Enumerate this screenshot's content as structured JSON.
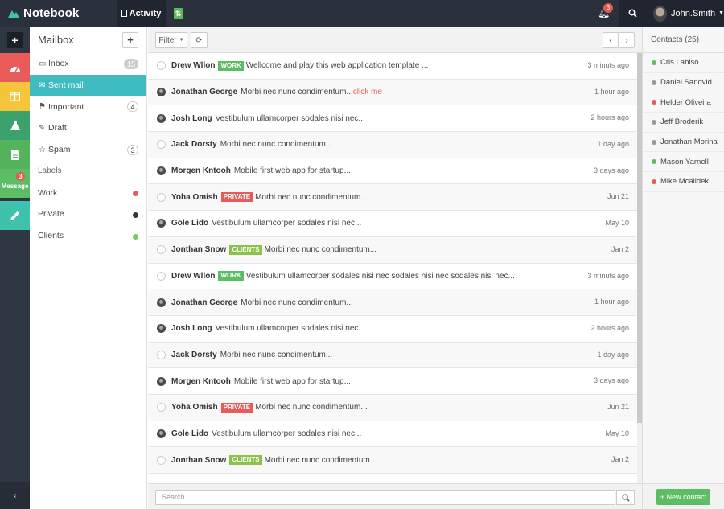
{
  "brand": {
    "name": "Notebook"
  },
  "topbar": {
    "activity_label": "Activity",
    "toggle_label": "⇅",
    "notifications_count": "3",
    "user_name": "John.Smith"
  },
  "iconbar": {
    "message_label": "Message",
    "message_badge": "3"
  },
  "mailbox": {
    "title": "Mailbox",
    "folders": [
      {
        "label": "Inbox",
        "icon": "inbox-icon",
        "glyph": "▭",
        "count": "15"
      },
      {
        "label": "Sent mail",
        "icon": "sent-mail-icon",
        "glyph": "✉",
        "count": ""
      },
      {
        "label": "Important",
        "icon": "bookmark-icon",
        "glyph": "⚑",
        "count": "4"
      },
      {
        "label": "Draft",
        "icon": "pencil-icon",
        "glyph": "✎",
        "count": ""
      },
      {
        "label": "Spam",
        "icon": "star-icon",
        "glyph": "☆",
        "count": "3"
      }
    ],
    "labels_heading": "Labels",
    "labels": [
      {
        "label": "Work",
        "color": "#e85b58"
      },
      {
        "label": "Private",
        "color": "#2f3742"
      },
      {
        "label": "Clients",
        "color": "#7dc95e"
      }
    ]
  },
  "toolbar": {
    "filter_label": "Filter"
  },
  "messages": [
    {
      "sender": "Drew Wllon",
      "tag": "WORK",
      "tag_type": "work",
      "text": "Wellcome and play this web application template ...",
      "link": "",
      "time": "3 minuts ago",
      "avatar": "empty"
    },
    {
      "sender": "Jonathan George",
      "tag": "",
      "tag_type": "",
      "text": "Morbi nec nunc condimentum...",
      "link": "click me",
      "time": "1 hour ago",
      "avatar": "photo"
    },
    {
      "sender": "Josh Long",
      "tag": "",
      "tag_type": "",
      "text": "Vestibulum ullamcorper sodales nisi nec...",
      "link": "",
      "time": "2 hours ago",
      "avatar": "photo"
    },
    {
      "sender": "Jack Dorsty",
      "tag": "",
      "tag_type": "",
      "text": "Morbi nec nunc condimentum...",
      "link": "",
      "time": "1 day ago",
      "avatar": "empty"
    },
    {
      "sender": "Morgen Kntooh",
      "tag": "",
      "tag_type": "",
      "text": "Mobile first web app for startup...",
      "link": "",
      "time": "3 days ago",
      "avatar": "photo"
    },
    {
      "sender": "Yoha Omish",
      "tag": "PRIVATE",
      "tag_type": "private",
      "text": "Morbi nec nunc condimentum...",
      "link": "",
      "time": "Jun 21",
      "avatar": "empty"
    },
    {
      "sender": "Gole Lido",
      "tag": "",
      "tag_type": "",
      "text": "Vestibulum ullamcorper sodales nisi nec...",
      "link": "",
      "time": "May 10",
      "avatar": "photo"
    },
    {
      "sender": "Jonthan Snow",
      "tag": "CLIENTS",
      "tag_type": "clients",
      "text": "Morbi nec nunc condimentum...",
      "link": "",
      "time": "Jan 2",
      "avatar": "empty"
    },
    {
      "sender": "Drew Wllon",
      "tag": "WORK",
      "tag_type": "work",
      "text": "Vestibulum ullamcorper sodales nisi nec sodales nisi nec sodales nisi nec...",
      "link": "",
      "time": "3 minuts ago",
      "avatar": "empty"
    },
    {
      "sender": "Jonathan George",
      "tag": "",
      "tag_type": "",
      "text": "Morbi nec nunc condimentum...",
      "link": "",
      "time": "1 hour ago",
      "avatar": "photo"
    },
    {
      "sender": "Josh Long",
      "tag": "",
      "tag_type": "",
      "text": "Vestibulum ullamcorper sodales nisi nec...",
      "link": "",
      "time": "2 hours ago",
      "avatar": "photo"
    },
    {
      "sender": "Jack Dorsty",
      "tag": "",
      "tag_type": "",
      "text": "Morbi nec nunc condimentum...",
      "link": "",
      "time": "1 day ago",
      "avatar": "empty"
    },
    {
      "sender": "Morgen Kntooh",
      "tag": "",
      "tag_type": "",
      "text": "Mobile first web app for startup...",
      "link": "",
      "time": "3 days ago",
      "avatar": "photo"
    },
    {
      "sender": "Yoha Omish",
      "tag": "PRIVATE",
      "tag_type": "private",
      "text": "Morbi nec nunc condimentum...",
      "link": "",
      "time": "Jun 21",
      "avatar": "empty"
    },
    {
      "sender": "Gole Lido",
      "tag": "",
      "tag_type": "",
      "text": "Vestibulum ullamcorper sodales nisi nec...",
      "link": "",
      "time": "May 10",
      "avatar": "photo"
    },
    {
      "sender": "Jonthan Snow",
      "tag": "CLIENTS",
      "tag_type": "clients",
      "text": "Morbi nec nunc condimentum...",
      "link": "",
      "time": "Jan 2",
      "avatar": "empty"
    }
  ],
  "search": {
    "placeholder": "Search"
  },
  "contacts": {
    "heading": "Contacts (25)",
    "list": [
      {
        "name": "Cris Labiso",
        "status": "#5dbd64"
      },
      {
        "name": "Daniel Sandvid",
        "status": "#999999"
      },
      {
        "name": "Helder Oliveira",
        "status": "#e85b58"
      },
      {
        "name": "Jeff Broderik",
        "status": "#999999"
      },
      {
        "name": "Jonathan Morina",
        "status": "#999999"
      },
      {
        "name": "Mason Yarnell",
        "status": "#5dbd64"
      },
      {
        "name": "Mike Mcalidek",
        "status": "#e85b58"
      }
    ],
    "new_contact_label": "New contact"
  }
}
